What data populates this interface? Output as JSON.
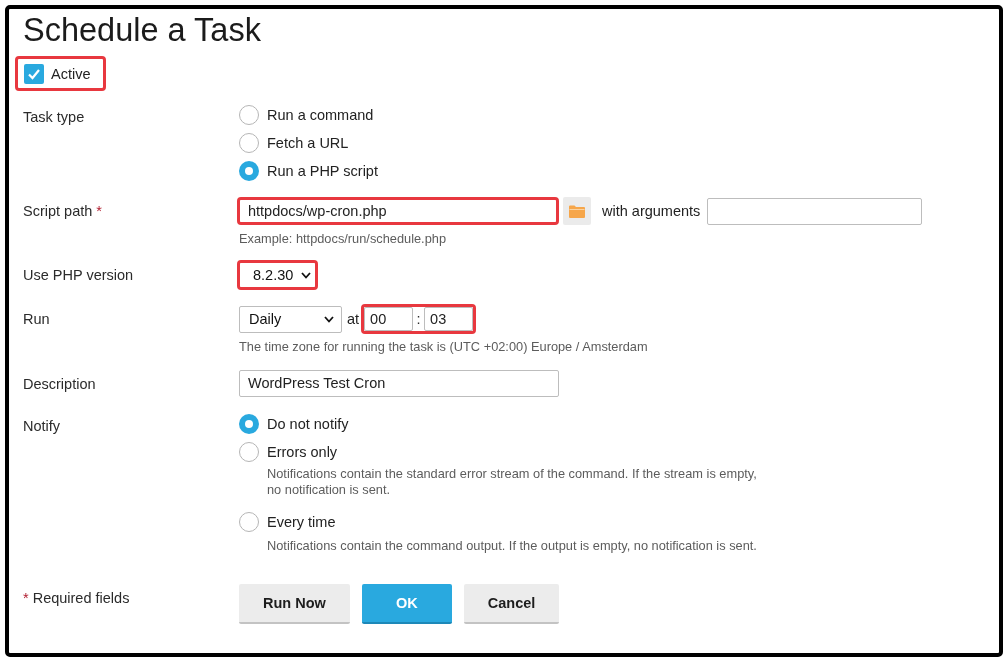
{
  "title": "Schedule a Task",
  "active": {
    "label": "Active",
    "checked": true,
    "highlighted": true
  },
  "task_type": {
    "label": "Task type",
    "options": [
      {
        "label": "Run a command",
        "selected": false
      },
      {
        "label": "Fetch a URL",
        "selected": false
      },
      {
        "label": "Run a PHP script",
        "selected": true
      }
    ]
  },
  "script_path": {
    "label": "Script path",
    "required_mark": "*",
    "value": "httpdocs/wp-cron.php",
    "highlighted": true,
    "arguments_label": "with arguments",
    "hint": "Example: httpdocs/run/schedule.php"
  },
  "php_version": {
    "label": "Use PHP version",
    "value": "8.2.30",
    "highlighted": true
  },
  "run": {
    "label": "Run",
    "frequency": "Daily",
    "at_label": "at",
    "hour": "00",
    "separator": ":",
    "minute": "03",
    "highlighted": true,
    "hint": "The time zone for running the task is (UTC +02:00) Europe / Amsterdam"
  },
  "description": {
    "label": "Description",
    "value": "WordPress Test Cron"
  },
  "notify": {
    "label": "Notify",
    "options": [
      {
        "label": "Do not notify",
        "selected": true
      },
      {
        "label": "Errors only",
        "selected": false,
        "hint": "Notifications contain the standard error stream of the command. If the stream is empty, no notification is sent."
      },
      {
        "label": "Every time",
        "selected": false,
        "hint": "Notifications contain the command output. If the output is empty, no notification is sent."
      }
    ]
  },
  "footer": {
    "required_mark": "*",
    "required_label": "Required fields",
    "buttons": [
      {
        "label": "Run Now",
        "kind": "secondary"
      },
      {
        "label": "OK",
        "kind": "primary"
      },
      {
        "label": "Cancel",
        "kind": "secondary"
      }
    ]
  }
}
